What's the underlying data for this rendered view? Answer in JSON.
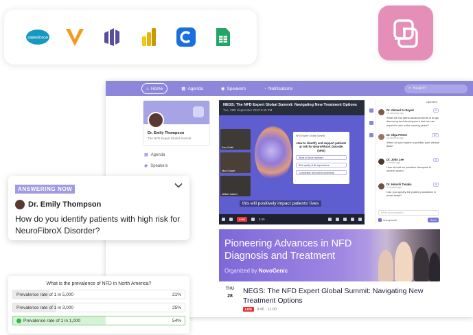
{
  "integrations": {
    "salesforce_text": "salesforce",
    "icons": [
      "salesforce-logo",
      "veeva-logo",
      "marketo-logo",
      "power-bi-logo",
      "cvent-logo",
      "google-sheets-logo"
    ]
  },
  "brand": {
    "accent": "#8b87db",
    "logo_color": "#e58fb8"
  },
  "topnav": {
    "home": "Home",
    "agenda": "Agenda",
    "speakers": "Speakers",
    "notifications": "Notifications",
    "search_placeholder": "Search"
  },
  "sidebar": {
    "name": "Dr. Emily Thompson",
    "subtitle": "The NFD Expert Global Summit",
    "items": [
      {
        "label": "Agenda"
      },
      {
        "label": "Speakers"
      }
    ]
  },
  "video": {
    "title": "NEGS: The NFD Expert Global Summit: Navigating New Treatment Options",
    "date": "Tue, 28th September 2023 9:45 PM",
    "cams": [
      "Sara Smith",
      "Nina Cooper",
      "William Adams"
    ],
    "slide": {
      "small": "NFD Expert Global Summit",
      "title": "How to identify and support patients at risk for NeuroFibroX Disorder (NFD)",
      "options": [
        "Weak in Nerve receptors",
        "Birth quality of life impressions",
        "Comparable well wishes treatments"
      ]
    },
    "caption": "this will positively impact patients' lives",
    "live": "LIVE",
    "time": "5:45"
  },
  "chat": {
    "header": "Upvotes",
    "messages": [
      {
        "name": "Dr. Ahmed Al-Sayed",
        "ago": "10 seconds ago",
        "text": "What are the latest advancements in drugs discovery and development that we can expect to see in the coming years?",
        "votes": "5"
      },
      {
        "name": "Dr. Olga Petrov",
        "ago": "42 seconds ago",
        "text": "When do you expect to publish your clinical data?",
        "votes": "17"
      },
      {
        "name": "Dr. John Lee",
        "ago": "1 minute ago",
        "text": "How should we prioritize therapies in severe cases?",
        "votes": "5"
      },
      {
        "name": "Dr. Hiroshi Tanaka",
        "ago": "2 minutes ago",
        "text": "Can you specify the patient population in more detail?",
        "votes": "5"
      }
    ],
    "ask_placeholder": "Write your question...",
    "anonymous": "Anonymous",
    "send": "Send"
  },
  "banner": {
    "line1": "Pioneering Advances in NFD",
    "line2": "Diagnosis and Treatment",
    "org_prefix": "Organized by",
    "org": "NovoGenic"
  },
  "event": {
    "day": "THU",
    "date": "28",
    "title": "NEGS: The NFD Expert Global Summit: Navigating New Treatment Options",
    "live": "LIVE",
    "time": "9:45 - 11:00"
  },
  "answering": {
    "badge": "ANSWERING NOW",
    "speaker": "Dr. Emily Thompson",
    "question": "How do you identify patients with high risk for NeuroFibroX Disorder?"
  },
  "poll": {
    "question": "What is the prevalence of NFD in North America?",
    "options": [
      {
        "label": "Prevalence rate of 1 in 5,000",
        "pct": "21%",
        "value": 0.21,
        "selected": false
      },
      {
        "label": "Prevalence rate of 1 in 3,000",
        "pct": "25%",
        "value": 0.25,
        "selected": false
      },
      {
        "label": "Prevalence rate of 1 in 1,000",
        "pct": "54%",
        "value": 0.54,
        "selected": true
      }
    ]
  }
}
